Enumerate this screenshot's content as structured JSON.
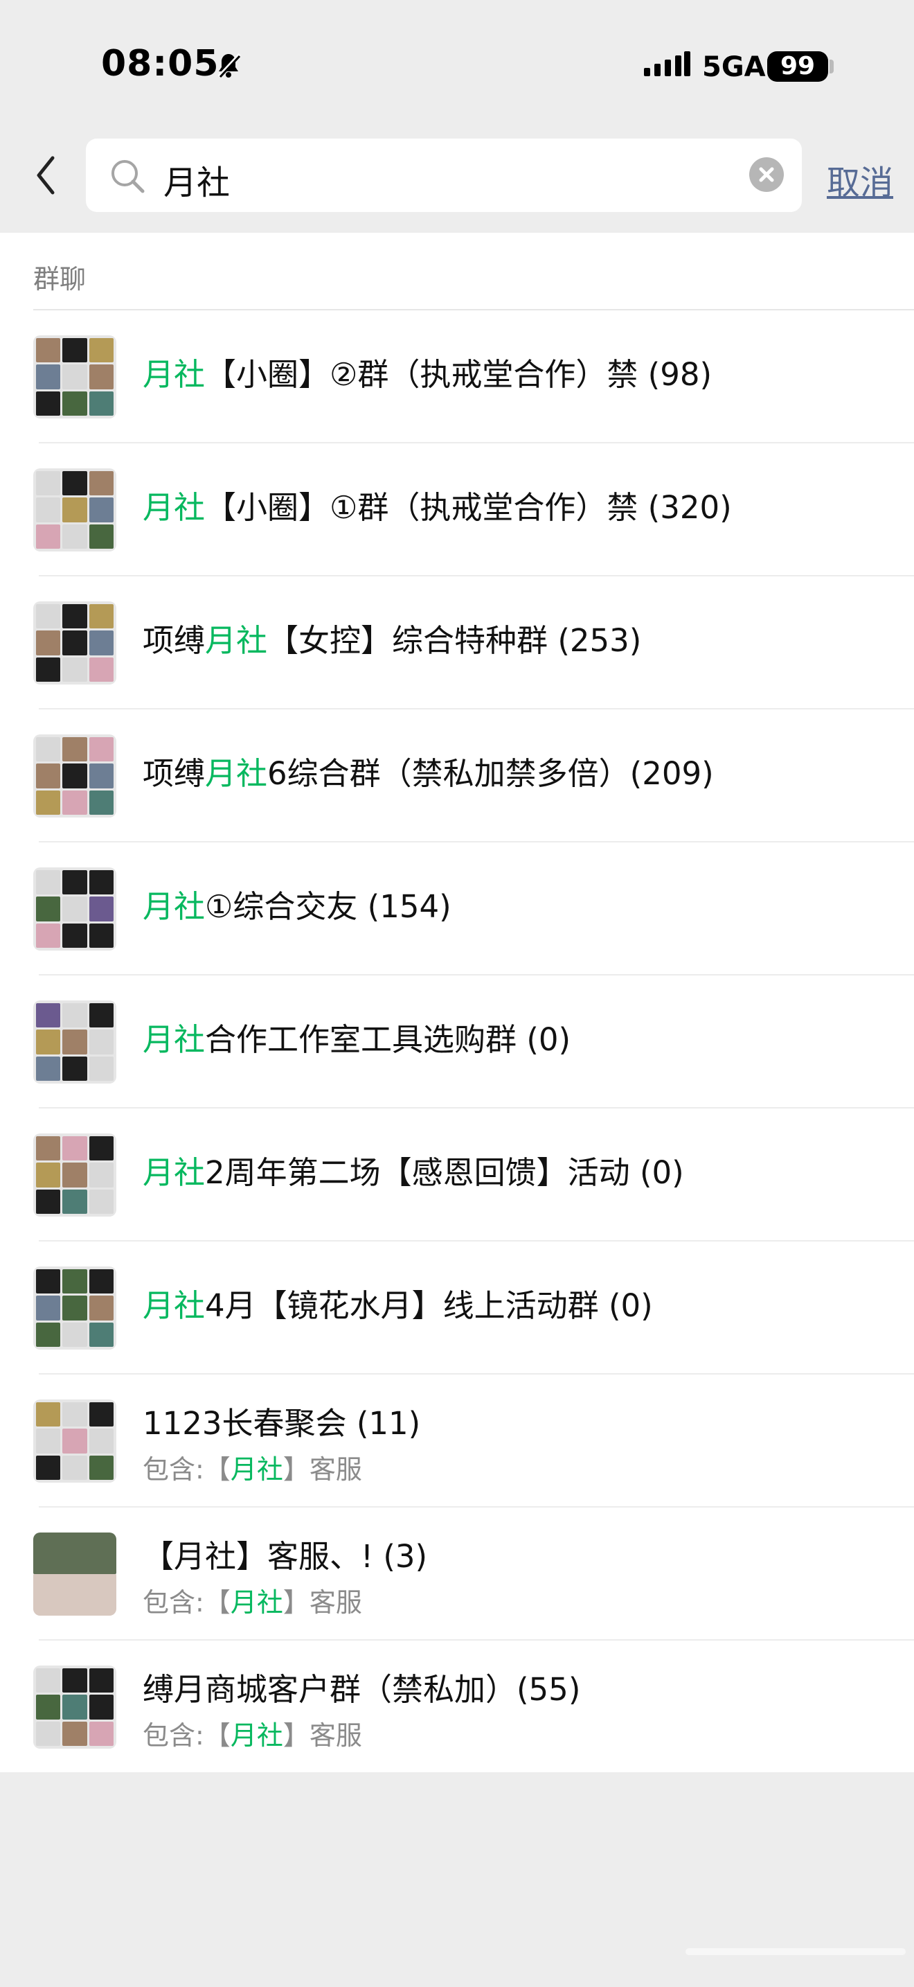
{
  "status_bar": {
    "time": "08:05",
    "network": "5GA",
    "battery": "99"
  },
  "search": {
    "query": "月社",
    "cancel_label": "取消"
  },
  "section": {
    "title": "群聊"
  },
  "results": [
    {
      "title_pre": "",
      "title_highlight": "月社",
      "title_post": "【小圈】②群（执戒堂合作）禁 (98)"
    },
    {
      "title_pre": "",
      "title_highlight": "月社",
      "title_post": "【小圈】①群（执戒堂合作）禁 (320)"
    },
    {
      "title_pre": "项缚",
      "title_highlight": "月社",
      "title_post": "【女控】综合特种群 (253)"
    },
    {
      "title_pre": "项缚",
      "title_highlight": "月社",
      "title_post": "6综合群（禁私加禁多倍）(209)"
    },
    {
      "title_pre": "",
      "title_highlight": "月社",
      "title_post": "①综合交友 (154)"
    },
    {
      "title_pre": "",
      "title_highlight": "月社",
      "title_post": "合作工作室工具选购群 (0)"
    },
    {
      "title_pre": "",
      "title_highlight": "月社",
      "title_post": "2周年第二场【感恩回馈】活动 (0)"
    },
    {
      "title_pre": "",
      "title_highlight": "月社",
      "title_post": "4月【镜花水月】线上活动群 (0)"
    },
    {
      "title": "1123长春聚会 (11)",
      "subtitle_pre": "包含:【",
      "subtitle_highlight": "月社",
      "subtitle_post": "】客服"
    },
    {
      "title": "【月社】客服、!   (3)",
      "subtitle_pre": "包含:【",
      "subtitle_highlight": "月社",
      "subtitle_post": "】客服"
    },
    {
      "title": "缚月商城客户群（禁私加）(55)",
      "subtitle_pre": "包含:【",
      "subtitle_highlight": "月社",
      "subtitle_post": "】客服"
    }
  ]
}
